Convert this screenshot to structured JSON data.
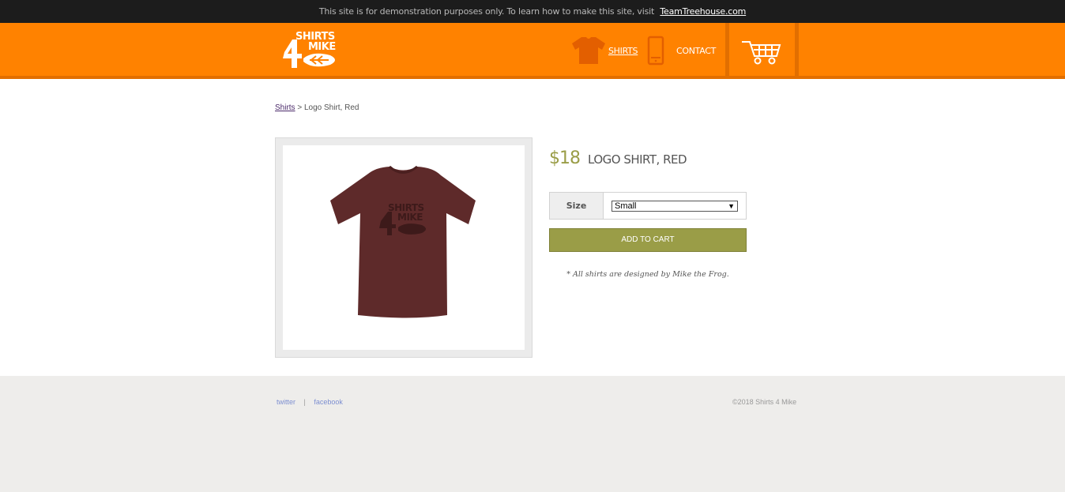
{
  "banner": {
    "text": "This site is for demonstration purposes only. To learn how to make this site, visit",
    "link": "TeamTreehouse.com"
  },
  "header": {
    "logo_icon": "shirts-4-mike-logo",
    "nav": [
      {
        "label": "SHIRTS",
        "icon": "tshirt-icon"
      },
      {
        "label": "CONTACT",
        "icon": "phone-icon"
      }
    ],
    "cart_icon": "cart-icon",
    "colors": {
      "brand": "#ff8200",
      "brand_dark": "#e26f00"
    }
  },
  "breadcrumb": {
    "link": "Shirts",
    "separator": ">",
    "current": "Logo Shirt, Red"
  },
  "product": {
    "price": "$18",
    "name": "LOGO SHIRT, RED",
    "size_label": "Size",
    "size_selected": "Small",
    "add_to_cart": "ADD TO CART",
    "note": "* All shirts are designed by Mike the Frog.",
    "shirt_logo_text_top": "SHIRTS",
    "shirt_logo_text_mid": "MIKE",
    "colors": {
      "shirt": "#5e2a2a",
      "accent": "#9a9d47"
    }
  },
  "footer": {
    "twitter": "twitter",
    "separator": "|",
    "facebook": "facebook",
    "copyright": "©2018 Shirts 4 Mike"
  }
}
